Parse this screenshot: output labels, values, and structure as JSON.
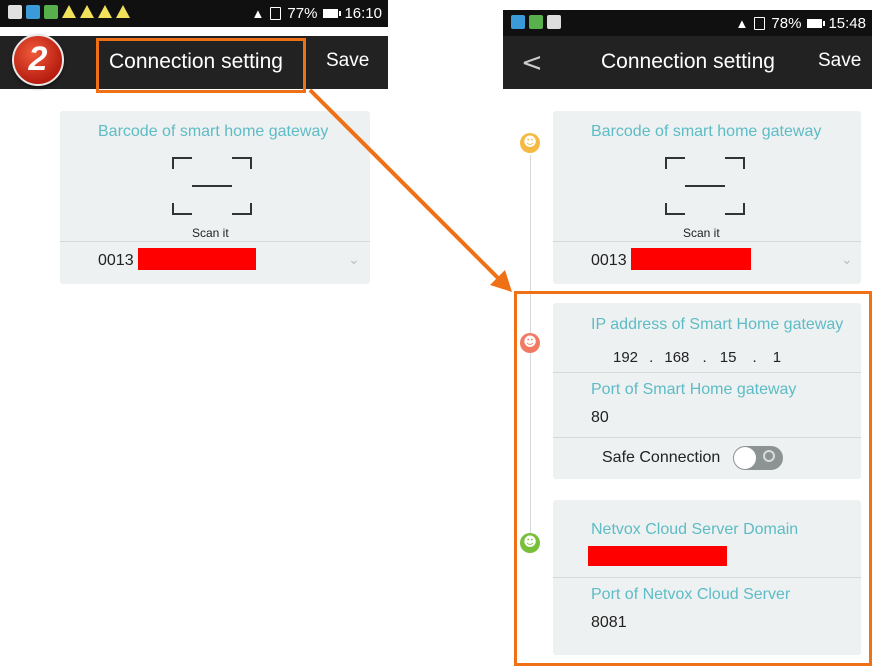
{
  "annotation": {
    "step_number": "2",
    "highlight_color": "#f07016"
  },
  "left_screen": {
    "status": {
      "battery": "77%",
      "time": "16:10"
    },
    "appbar": {
      "title": "Connection setting",
      "save_label": "Save"
    },
    "barcode_card": {
      "label": "Barcode of smart home gateway",
      "scan_label": "Scan it",
      "value_prefix": "0013"
    }
  },
  "right_screen": {
    "status": {
      "battery": "78%",
      "time": "15:48"
    },
    "appbar": {
      "title": "Connection setting",
      "save_label": "Save"
    },
    "barcode_card": {
      "label": "Barcode of smart home gateway",
      "scan_label": "Scan it",
      "value_prefix": "0013"
    },
    "gateway_card": {
      "ip_label": "IP address of Smart Home gateway",
      "ip": [
        "192",
        "168",
        "15",
        "1"
      ],
      "ip_sep": ".",
      "port_label": "Port of Smart Home gateway",
      "port_value": "80",
      "safe_label": "Safe Connection"
    },
    "cloud_card": {
      "domain_label": "Netvox Cloud Server Domain",
      "port_label": "Port of Netvox Cloud Server",
      "port_value": "8081"
    }
  },
  "colors": {
    "label": "#5dbcc6",
    "card_bg": "#eef1f1",
    "appbar_bg": "#222222",
    "redaction": "#ff0000"
  },
  "icons": {
    "face_yellow": "smiley-yellow-icon",
    "face_red": "smiley-red-icon",
    "face_green": "smiley-green-icon"
  }
}
